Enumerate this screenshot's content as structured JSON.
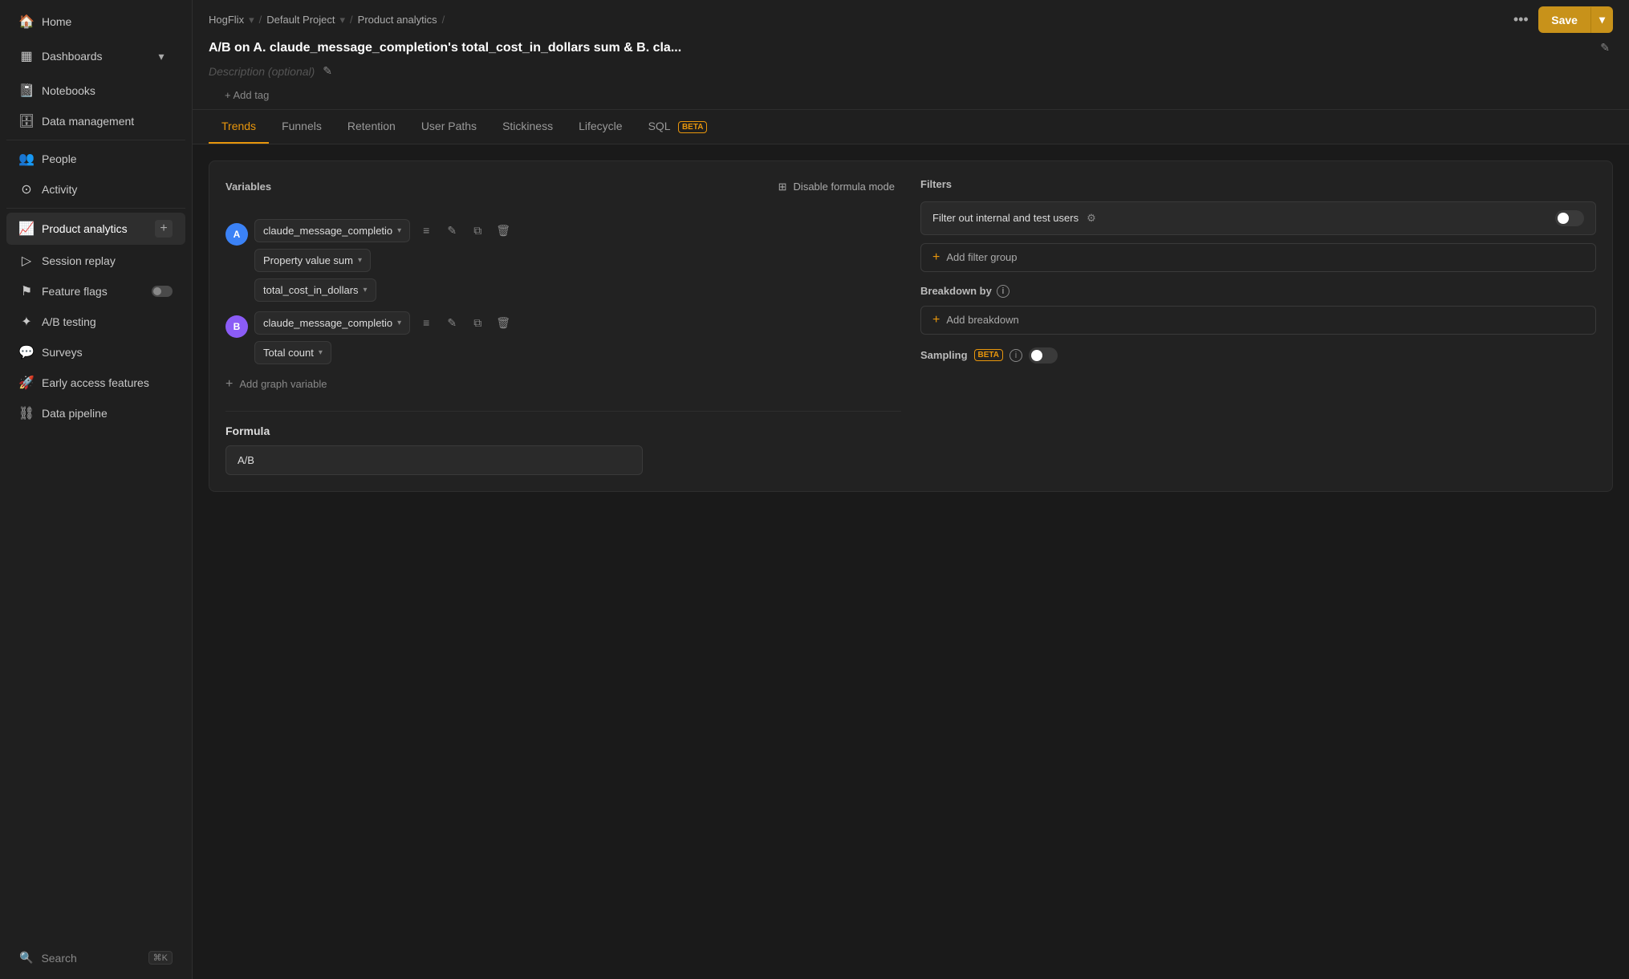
{
  "sidebar": {
    "org": "HogFlix",
    "items": [
      {
        "id": "home",
        "label": "Home",
        "icon": "🏠",
        "active": false
      },
      {
        "id": "dashboards",
        "label": "Dashboards",
        "icon": "📊",
        "active": false,
        "hasToggle": true
      },
      {
        "id": "notebooks",
        "label": "Notebooks",
        "icon": "📓",
        "active": false
      },
      {
        "id": "data-management",
        "label": "Data management",
        "icon": "🗄️",
        "active": false
      },
      {
        "id": "people",
        "label": "People",
        "icon": "👥",
        "active": false
      },
      {
        "id": "activity",
        "label": "Activity",
        "icon": "📡",
        "active": false
      },
      {
        "id": "product-analytics",
        "label": "Product analytics",
        "icon": "📈",
        "active": true,
        "hasPlus": true
      },
      {
        "id": "session-replay",
        "label": "Session replay",
        "icon": "▶️",
        "active": false
      },
      {
        "id": "feature-flags",
        "label": "Feature flags",
        "icon": "🚩",
        "active": false,
        "hasSwitch": true
      },
      {
        "id": "ab-testing",
        "label": "A/B testing",
        "icon": "🧪",
        "active": false
      },
      {
        "id": "surveys",
        "label": "Surveys",
        "icon": "💬",
        "active": false
      },
      {
        "id": "early-access",
        "label": "Early access features",
        "icon": "🚀",
        "active": false
      },
      {
        "id": "data-pipeline",
        "label": "Data pipeline",
        "icon": "🔗",
        "active": false
      }
    ],
    "search_label": "Search",
    "search_shortcut": "⌘K"
  },
  "breadcrumb": {
    "parts": [
      "HogFlix",
      "Default Project",
      "Product analytics"
    ]
  },
  "topbar": {
    "title": "A/B on A. claude_message_completion's total_cost_in_dollars sum & B. cla...",
    "more_label": "⋯",
    "save_label": "Save"
  },
  "description": {
    "placeholder": "Description (optional)"
  },
  "add_tag_label": "+ Add tag",
  "tabs": [
    {
      "id": "trends",
      "label": "Trends",
      "active": true
    },
    {
      "id": "funnels",
      "label": "Funnels",
      "active": false
    },
    {
      "id": "retention",
      "label": "Retention",
      "active": false
    },
    {
      "id": "user-paths",
      "label": "User Paths",
      "active": false
    },
    {
      "id": "stickiness",
      "label": "Stickiness",
      "active": false
    },
    {
      "id": "lifecycle",
      "label": "Lifecycle",
      "active": false
    },
    {
      "id": "sql",
      "label": "SQL",
      "active": false,
      "beta": true
    }
  ],
  "panel": {
    "variables_label": "Variables",
    "formula_mode_btn": "Disable formula mode",
    "filters_label": "Filters",
    "filter_internal_label": "Filter out internal and test users",
    "filter_toggle_on": false,
    "add_filter_group_label": "Add filter group",
    "breakdown_label": "Breakdown by",
    "add_breakdown_label": "Add breakdown",
    "sampling_label": "Sampling",
    "sampling_toggle_on": false,
    "variable_a": {
      "letter": "A",
      "event_name": "claude_message_completio",
      "aggregation": "Property value sum",
      "property": "total_cost_in_dollars"
    },
    "variable_b": {
      "letter": "B",
      "event_name": "claude_message_completio",
      "aggregation": "Total count"
    },
    "add_graph_variable_label": "Add graph variable",
    "formula_section_label": "Formula",
    "formula_value": "A/B"
  }
}
